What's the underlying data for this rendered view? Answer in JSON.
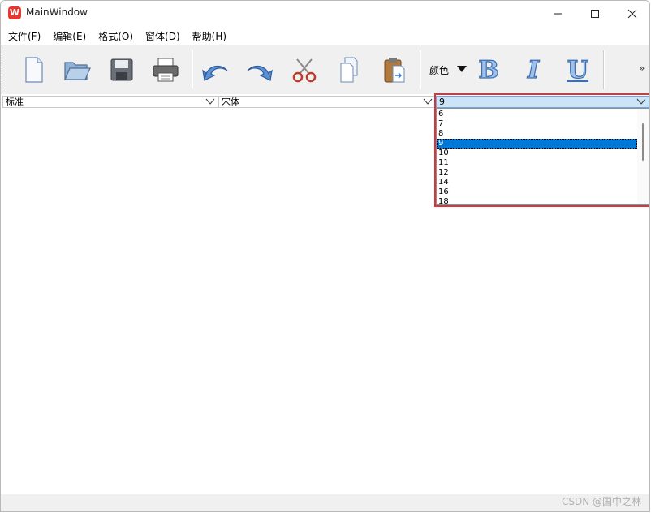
{
  "window": {
    "title": "MainWindow",
    "app_icon_glyph": "W",
    "controls": [
      "minimize-icon",
      "maximize-icon",
      "close-icon"
    ]
  },
  "menu": [
    {
      "label": "文件(F)"
    },
    {
      "label": "编辑(E)"
    },
    {
      "label": "格式(O)"
    },
    {
      "label": "窗体(D)"
    },
    {
      "label": "帮助(H)"
    }
  ],
  "toolbar": {
    "buttons": [
      "new-file-icon",
      "open-folder-icon",
      "save-icon",
      "print-icon",
      "undo-icon",
      "redo-icon",
      "cut-icon",
      "copy-icon",
      "paste-icon"
    ],
    "color_label": "颜色",
    "bold_label": "B",
    "italic_label": "I",
    "underline_label": "U",
    "overflow_label": "»"
  },
  "combos": {
    "style": {
      "value": "标准"
    },
    "font": {
      "value": "宋体"
    },
    "size": {
      "value": "9"
    }
  },
  "size_dropdown": {
    "options": [
      "6",
      "7",
      "8",
      "9",
      "10",
      "11",
      "12",
      "14",
      "16",
      "18"
    ],
    "selected": "9"
  },
  "watermark": "CSDN @国中之林",
  "colors": {
    "accent_selection": "#0078d7",
    "highlight_border": "#e0323a",
    "app_icon": "#e8352e"
  }
}
